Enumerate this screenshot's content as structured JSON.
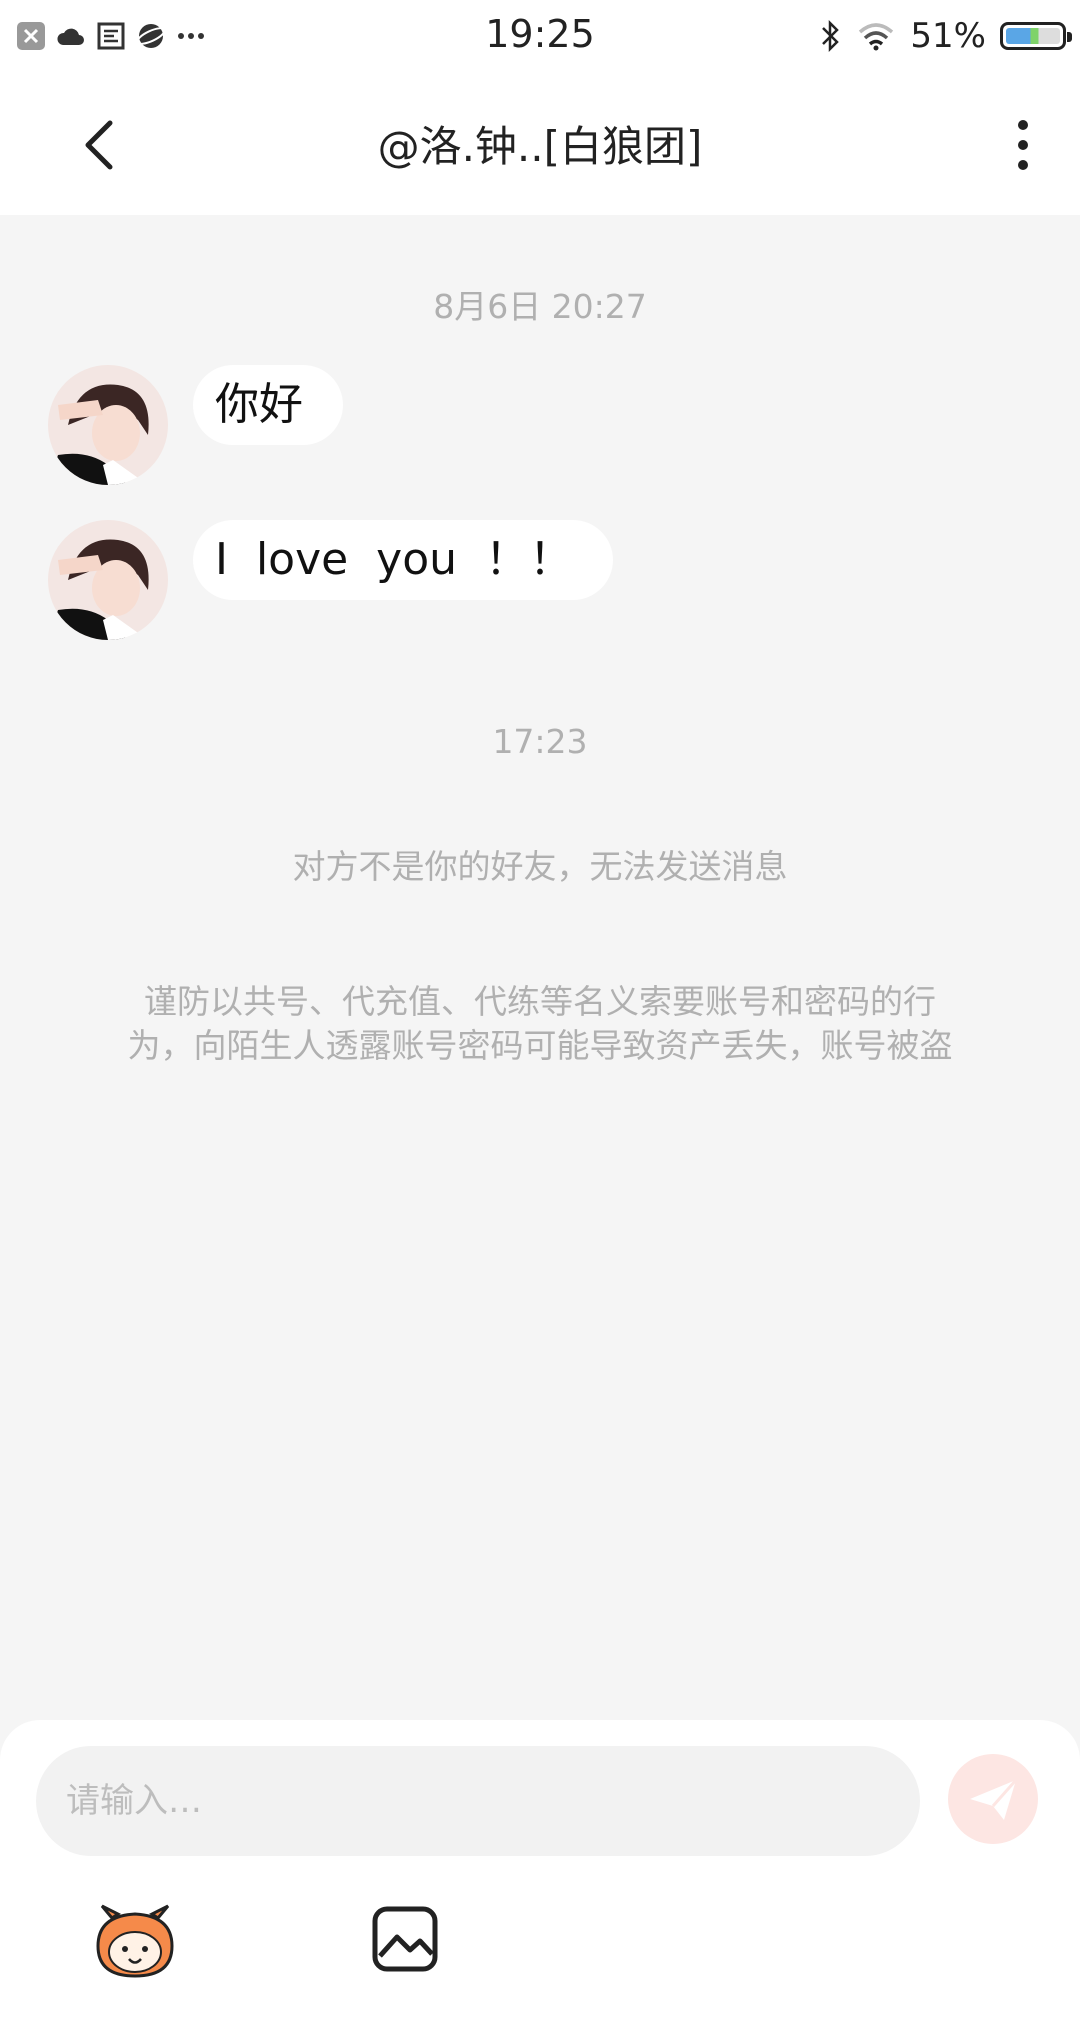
{
  "status_bar": {
    "time": "19:25",
    "battery_text": "51%",
    "left_icons": [
      "close-notification-icon",
      "cloud-icon",
      "news-icon",
      "planet-icon",
      "more-dots-icon"
    ],
    "right_icons": [
      "bluetooth-icon",
      "wifi-icon",
      "battery-icon"
    ]
  },
  "header": {
    "title": "@洛.钟..[白狼团]",
    "back_icon": "chevron-left-icon",
    "more_icon": "vertical-dots-icon"
  },
  "chat": {
    "timestamp_1": "8月6日 20:27",
    "messages": [
      {
        "text": "你好"
      },
      {
        "text": "I  love  you  ！！"
      }
    ],
    "timestamp_2": "17:23",
    "system_notice": "对方不是你的好友，无法发送消息",
    "warning_line1": "谨防以共号、代充值、代练等名义索要账号和密码的行",
    "warning_line2": "为，向陌生人透露账号密码可能导致资产丢失，账号被盗"
  },
  "composer": {
    "placeholder": "请输入…",
    "send_icon": "send-icon",
    "emoji_icon": "mascot-emoji-icon",
    "image_icon": "image-icon"
  },
  "colors": {
    "background": "#f5f5f5",
    "bubble": "#ffffff",
    "muted_text": "#b0b0b0",
    "send_button": "#fde6e3"
  }
}
